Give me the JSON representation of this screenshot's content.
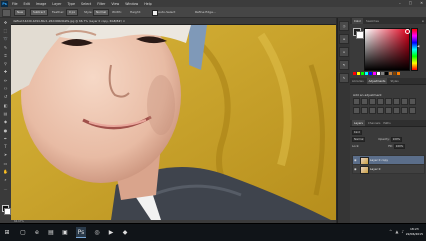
{
  "app": {
    "logo": "Ps"
  },
  "menubar": {
    "items": [
      "File",
      "Edit",
      "Image",
      "Layer",
      "Type",
      "Select",
      "Filter",
      "View",
      "Window",
      "Help"
    ],
    "window_controls": [
      "–",
      "□",
      "✕"
    ]
  },
  "options": {
    "btn1": "New",
    "btn2": "Subtract",
    "feather_label": "Feather:",
    "feather_value": "0 px",
    "style_label": "Style:",
    "style_value": "Normal",
    "width_label": "Width:",
    "height_label": "Height:",
    "auto_label": "Auto-Select",
    "refine_label": "Refine Edge..."
  },
  "document": {
    "tab_title": "defbe1f-4dd9-4d94-8bc1-26dd90b9b2fe.jpg @ 66.7% (Layer 0 copy, RGB/8#) ×",
    "status": "66.67%"
  },
  "panels": {
    "color_tabs": [
      "Color",
      "Swatches"
    ],
    "adjust_tabs": [
      "Libraries",
      "Adjustments",
      "Styles"
    ],
    "adjust_title": "Add an adjustment",
    "layers_tabs": [
      "Layers",
      "Channels",
      "Paths"
    ],
    "kind_label": "Kind",
    "blend_mode": "Normal",
    "opacity_label": "Opacity:",
    "opacity_value": "100%",
    "lock_label": "Lock:",
    "fill_label": "Fill:",
    "fill_value": "100%",
    "layers": [
      {
        "name": "Layer 0 copy",
        "selected": true
      },
      {
        "name": "Layer 0",
        "selected": false
      }
    ],
    "footer_icons": [
      "link-icon",
      "fx-icon",
      "mask-icon",
      "adjust-icon",
      "folder-icon",
      "new-layer-icon",
      "trash-icon"
    ]
  },
  "colors": {
    "picker_hue": "#e0001c",
    "swatches": [
      "#ff0000",
      "#ffff00",
      "#00ff00",
      "#00ffff",
      "#0000ff",
      "#ff00ff",
      "#ffffff",
      "#808080",
      "#000000",
      "#c08040",
      "#804000",
      "#ff8000"
    ]
  },
  "taskbar": {
    "icons": [
      "windows-start-icon",
      "task-view-icon",
      "edge-icon",
      "explorer-icon",
      "store-icon",
      "photoshop-icon",
      "chrome-icon",
      "media-icon",
      "misc-icon"
    ],
    "time": "18:23",
    "date": "22/06/2015"
  }
}
